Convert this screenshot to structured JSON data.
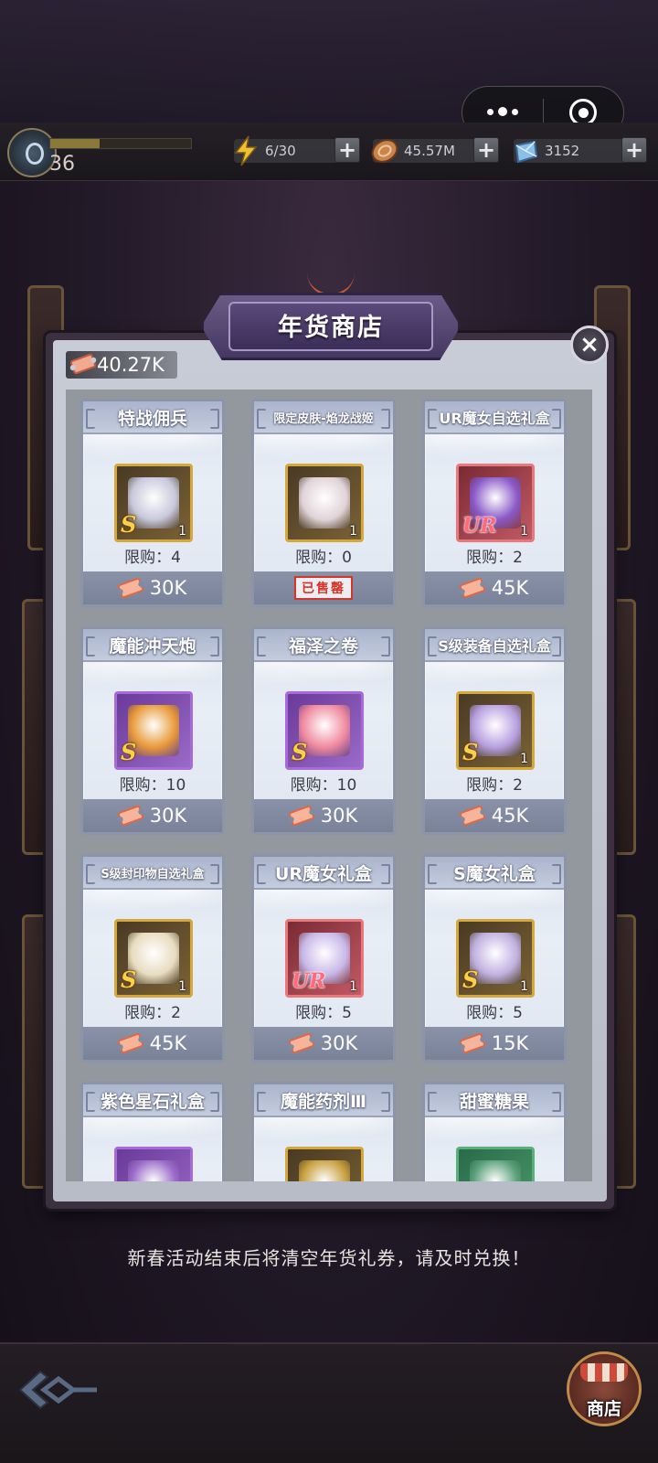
{
  "topbar": {
    "level": "36",
    "exp_fraction": 0.35,
    "energy": "6/30",
    "coins": "45.57M",
    "diamonds": "3152",
    "plus": "+"
  },
  "shop": {
    "title": "年货商店",
    "currency": "40.27K",
    "close": "×",
    "notice": "新春活动结束后将清空年货礼券，请及时兑换！",
    "items": [
      {
        "name": "特战佣兵",
        "limit": "限购：4",
        "price": "30K",
        "grade": "S",
        "qty": "1",
        "frame": "gold",
        "art": "#c8c8dc",
        "sold_out": false
      },
      {
        "name": "限定皮肤-焰龙战姬",
        "limit": "限购：0",
        "price": "",
        "grade": "",
        "qty": "1",
        "frame": "gold",
        "art": "#e0d4d8",
        "sold_out": true,
        "sold_label": "已售罄"
      },
      {
        "name": "UR魔女自选礼盒",
        "limit": "限购：2",
        "price": "45K",
        "grade": "UR",
        "qty": "1",
        "frame": "red",
        "art": "#8a5ac8",
        "sold_out": false
      },
      {
        "name": "魔能冲天炮",
        "limit": "限购：10",
        "price": "30K",
        "grade": "S",
        "qty": "",
        "frame": "purple",
        "art": "#e89a3a",
        "sold_out": false
      },
      {
        "name": "福泽之卷",
        "limit": "限购：10",
        "price": "30K",
        "grade": "S",
        "qty": "",
        "frame": "purple",
        "art": "#f08aa0",
        "sold_out": false
      },
      {
        "name": "S级装备自选礼盒",
        "limit": "限购：2",
        "price": "45K",
        "grade": "S",
        "qty": "1",
        "frame": "gold",
        "art": "#b8a0e0",
        "sold_out": false
      },
      {
        "name": "S级封印物自选礼盒",
        "limit": "限购：2",
        "price": "45K",
        "grade": "S",
        "qty": "1",
        "frame": "gold",
        "art": "#e8dcc0",
        "sold_out": false
      },
      {
        "name": "UR魔女礼盒",
        "limit": "限购：5",
        "price": "30K",
        "grade": "UR",
        "qty": "1",
        "frame": "red",
        "art": "#c8b8e8",
        "sold_out": false
      },
      {
        "name": "S魔女礼盒",
        "limit": "限购：5",
        "price": "15K",
        "grade": "S",
        "qty": "1",
        "frame": "gold",
        "art": "#c0b0e0",
        "sold_out": false
      },
      {
        "name": "紫色星石礼盒",
        "limit": "",
        "price": "",
        "grade": "",
        "qty": "",
        "frame": "purple",
        "art": "#9a6ac8",
        "sold_out": false
      },
      {
        "name": "魔能药剂Ⅲ",
        "limit": "",
        "price": "",
        "grade": "",
        "qty": "",
        "frame": "gold",
        "art": "#c8a040",
        "sold_out": false
      },
      {
        "name": "甜蜜糖果",
        "limit": "",
        "price": "",
        "grade": "",
        "qty": "",
        "frame": "green",
        "art": "#5aa07a",
        "sold_out": false
      }
    ]
  },
  "bottom": {
    "shop_label": "商店"
  }
}
